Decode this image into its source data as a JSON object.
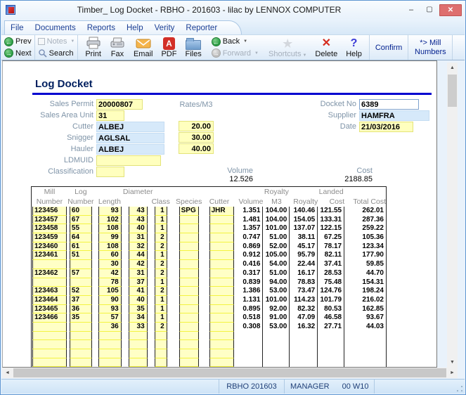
{
  "window": {
    "title": "Timber_ Log Docket - RBHO - 201603 - lilac by LENNOX COMPUTER"
  },
  "menu": {
    "items": [
      "File",
      "Documents",
      "Reports",
      "Help",
      "Verity",
      "Reporter"
    ]
  },
  "toolbar": {
    "prev": "Prev",
    "next": "Next",
    "notes": "Notes",
    "search": "Search",
    "print": "Print",
    "fax": "Fax",
    "email": "Email",
    "pdf": "PDF",
    "files": "Files",
    "back": "Back",
    "forward": "Forward",
    "shortcuts": "Shortcuts",
    "delete": "Delete",
    "help": "Help",
    "confirm": "Confirm",
    "mill_numbers": "*> Mill Numbers"
  },
  "icons": {
    "prev_arrow": "←",
    "next_arrow": "→",
    "back_arrow": "←",
    "forward_arrow": "→",
    "caret": "▼",
    "star": "★",
    "delete_x": "✕",
    "help_q": "?",
    "pdf_glyph": "A",
    "minimize": "–",
    "maximize": "▢",
    "close": "✕",
    "up": "▲",
    "down": "▼",
    "left": "◄",
    "right": "►"
  },
  "page": {
    "heading": "Log Docket"
  },
  "form": {
    "rates_label": "Rates/M3",
    "fields": [
      {
        "label": "Sales Permit",
        "value": "20000807",
        "type": "yellow",
        "width": 66
      },
      {
        "label": "Sales Area Unit",
        "value": "31",
        "type": "yellow",
        "width": 40
      },
      {
        "label": "Cutter",
        "value": "ALBEJ",
        "type": "blue",
        "width": 97,
        "rate": "20.00"
      },
      {
        "label": "Snigger",
        "value": "AGLSAL",
        "type": "blue",
        "width": 97,
        "rate": "30.00"
      },
      {
        "label": "Hauler",
        "value": "ALBEJ",
        "type": "blue",
        "width": 97,
        "rate": "40.00"
      },
      {
        "label": "LDMUID",
        "value": "",
        "type": "yellow",
        "width": 92
      },
      {
        "label": "Classification",
        "value": "",
        "type": "yellow",
        "width": 40
      }
    ],
    "right": [
      {
        "label": "Docket No",
        "value": "6389",
        "type": "white",
        "width": 85
      },
      {
        "label": "Supplier",
        "value": "HAMFRA",
        "type": "blue",
        "width": 100
      },
      {
        "label": "Date",
        "value": "21/03/2016",
        "type": "yellow",
        "width": 77
      }
    ]
  },
  "summary": {
    "volume_label": "Volume",
    "volume": "12.526",
    "cost_label": "Cost",
    "cost": "2188.85"
  },
  "table": {
    "header_row1": [
      "Mill",
      "Log",
      "",
      "Diameter",
      "",
      "",
      "",
      "",
      "Royalty",
      "",
      "Landed",
      ""
    ],
    "header_row2": [
      "Number",
      "Number",
      "Length",
      "",
      "Class",
      "Species",
      "Cutter",
      "Volume",
      "M3",
      "Royalty",
      "Cost",
      "Total Cost"
    ],
    "rows": [
      [
        "123456",
        "60",
        "93",
        "43",
        "1",
        "SPG",
        "JHR",
        "1.351",
        "104.00",
        "140.46",
        "121.55",
        "262.01"
      ],
      [
        "123457",
        "67",
        "102",
        "43",
        "1",
        "",
        "",
        "1.481",
        "104.00",
        "154.05",
        "133.31",
        "287.36"
      ],
      [
        "123458",
        "55",
        "108",
        "40",
        "1",
        "",
        "",
        "1.357",
        "101.00",
        "137.07",
        "122.15",
        "259.22"
      ],
      [
        "123459",
        "64",
        "99",
        "31",
        "2",
        "",
        "",
        "0.747",
        "51.00",
        "38.11",
        "67.25",
        "105.36"
      ],
      [
        "123460",
        "61",
        "108",
        "32",
        "2",
        "",
        "",
        "0.869",
        "52.00",
        "45.17",
        "78.17",
        "123.34"
      ],
      [
        "123461",
        "51",
        "60",
        "44",
        "1",
        "",
        "",
        "0.912",
        "105.00",
        "95.79",
        "82.11",
        "177.90"
      ],
      [
        "",
        "",
        "30",
        "42",
        "2",
        "",
        "",
        "0.416",
        "54.00",
        "22.44",
        "37.41",
        "59.85"
      ],
      [
        "123462",
        "57",
        "42",
        "31",
        "2",
        "",
        "",
        "0.317",
        "51.00",
        "16.17",
        "28.53",
        "44.70"
      ],
      [
        "",
        "",
        "78",
        "37",
        "1",
        "",
        "",
        "0.839",
        "94.00",
        "78.83",
        "75.48",
        "154.31"
      ],
      [
        "123463",
        "52",
        "105",
        "41",
        "2",
        "",
        "",
        "1.386",
        "53.00",
        "73.47",
        "124.76",
        "198.24"
      ],
      [
        "123464",
        "37",
        "90",
        "40",
        "1",
        "",
        "",
        "1.131",
        "101.00",
        "114.23",
        "101.79",
        "216.02"
      ],
      [
        "123465",
        "36",
        "93",
        "35",
        "1",
        "",
        "",
        "0.895",
        "92.00",
        "82.32",
        "80.53",
        "162.85"
      ],
      [
        "123466",
        "35",
        "57",
        "34",
        "1",
        "",
        "",
        "0.518",
        "91.00",
        "47.09",
        "46.58",
        "93.67"
      ],
      [
        "",
        "",
        "36",
        "33",
        "2",
        "",
        "",
        "0.308",
        "53.00",
        "16.32",
        "27.71",
        "44.03"
      ]
    ],
    "empty_row_count": 4
  },
  "statusbar": {
    "site": "RBHO 201603",
    "user": "MANAGER",
    "session": "00 W10"
  }
}
